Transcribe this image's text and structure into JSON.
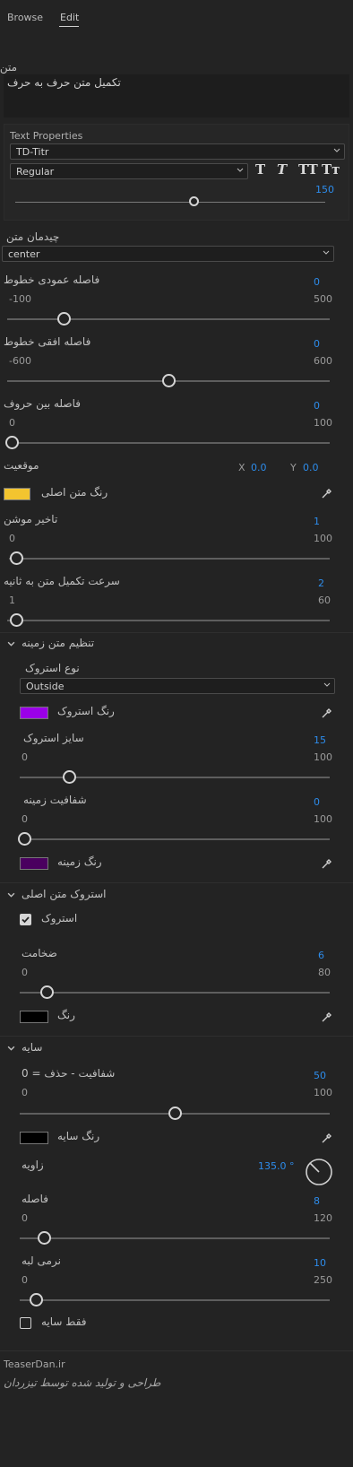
{
  "tabs": [
    {
      "label": "Browse"
    },
    {
      "label": "Edit"
    }
  ],
  "text_label": "متن",
  "text_value": "تکمیل متن حرف به حرف",
  "text_properties": {
    "title": "Text Properties",
    "font_family": "TD-Titr",
    "font_style": "Regular",
    "style_buttons": [
      "T",
      "T",
      "TT",
      "Tт"
    ],
    "size": "150",
    "size_fraction": 0.58
  },
  "alignment": {
    "label": "چیدمان متن",
    "value": "center"
  },
  "line_spacing_v": {
    "label": "فاصله عمودی خطوط",
    "value": "0",
    "min": "-100",
    "max": "500",
    "fraction": 0.167
  },
  "line_spacing_h": {
    "label": "فاصله افقی خطوط",
    "value": "0",
    "min": "-600",
    "max": "600",
    "fraction": 0.5
  },
  "letter_spacing": {
    "label": "فاصله بین حروف",
    "value": "0",
    "min": "0",
    "max": "100",
    "fraction": 0.0
  },
  "position": {
    "label": "موقعیت",
    "x_label": "X",
    "x_value": "0.0",
    "y_label": "Y",
    "y_value": "0.0"
  },
  "main_color": {
    "label": "رنگ متن اصلی",
    "color": "#f3c42f"
  },
  "motion_delay": {
    "label": "تاخیر موشن",
    "value": "1",
    "min": "0",
    "max": "100",
    "fraction": 0.01
  },
  "complete_speed": {
    "label": "سرعت تکمیل متن به ثانیه",
    "value": "2",
    "min": "1",
    "max": "60",
    "fraction": 0.017
  },
  "bg_section": {
    "title": "تنظیم متن زمینه",
    "stroke_type": {
      "label": "نوع استروک",
      "value": "Outside"
    },
    "stroke_color": {
      "label": "رنگ استروک",
      "color": "#9b00e8"
    },
    "stroke_size": {
      "label": "سایز استروک",
      "value": "15",
      "min": "0",
      "max": "100",
      "fraction": 0.15
    },
    "bg_opacity": {
      "label": "شفافیت زمینه",
      "value": "0",
      "min": "0",
      "max": "100",
      "fraction": 0.0
    },
    "bg_color": {
      "label": "رنگ زمینه",
      "color": "#4a005f"
    }
  },
  "main_stroke": {
    "title": "استروک متن اصلی",
    "checkbox": {
      "label": "استروک",
      "checked": true
    },
    "thickness": {
      "label": "ضخامت",
      "value": "6",
      "min": "0",
      "max": "80",
      "fraction": 0.075
    },
    "color": {
      "label": "رنگ",
      "color": "#000000"
    }
  },
  "shadow": {
    "title": "سایه",
    "opacity": {
      "label": "شفافیت - حذف = 0",
      "value": "50",
      "min": "0",
      "max": "100",
      "fraction": 0.5
    },
    "color": {
      "label": "رنگ سایه",
      "color": "#000000"
    },
    "angle": {
      "label": "زاویه",
      "value": "135.0 °"
    },
    "distance": {
      "label": "فاصله",
      "value": "8",
      "min": "0",
      "max": "120",
      "fraction": 0.067
    },
    "softness": {
      "label": "نرمی لبه",
      "value": "10",
      "min": "0",
      "max": "250",
      "fraction": 0.04
    },
    "shadow_only": {
      "label": "فقط سایه",
      "checked": false
    }
  },
  "footer": {
    "site": "TeaserDan.ir",
    "credit": "طراحی و تولید شده توسط تیزردان"
  },
  "colors": {
    "accent": "#2d8ceb",
    "panel": "#232323"
  }
}
